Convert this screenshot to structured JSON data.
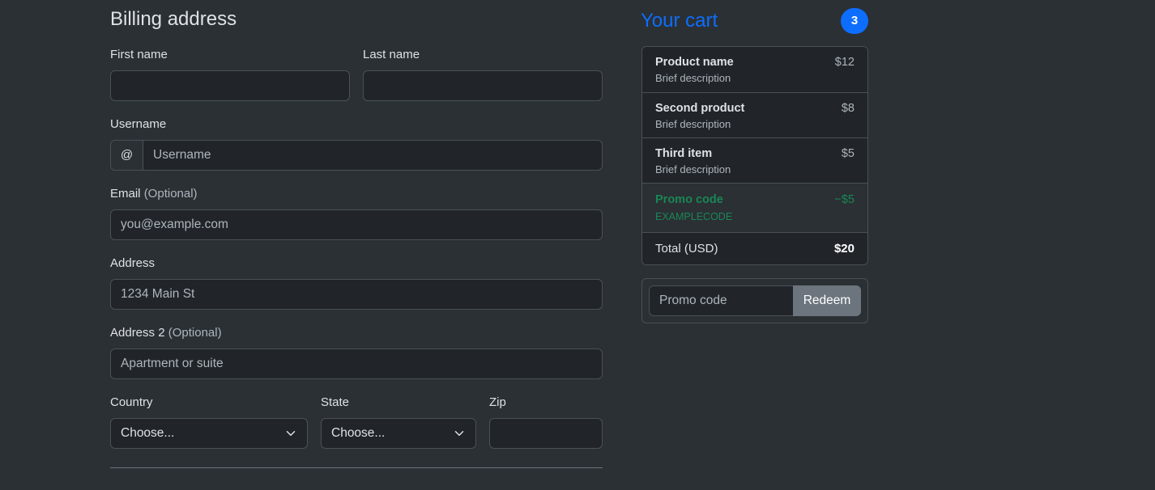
{
  "form": {
    "title": "Billing address",
    "first_name_label": "First name",
    "last_name_label": "Last name",
    "username_label": "Username",
    "username_prefix": "@",
    "username_placeholder": "Username",
    "email_label": "Email",
    "email_optional": "(Optional)",
    "email_placeholder": "you@example.com",
    "address_label": "Address",
    "address_value": "1234 Main St",
    "address2_label": "Address 2",
    "address2_optional": "(Optional)",
    "address2_placeholder": "Apartment or suite",
    "country_label": "Country",
    "country_selected": "Choose...",
    "state_label": "State",
    "state_selected": "Choose...",
    "zip_label": "Zip"
  },
  "cart": {
    "title": "Your cart",
    "count": "3",
    "items": [
      {
        "name": "Product name",
        "desc": "Brief description",
        "price": "$12"
      },
      {
        "name": "Second product",
        "desc": "Brief description",
        "price": "$8"
      },
      {
        "name": "Third item",
        "desc": "Brief description",
        "price": "$5"
      }
    ],
    "promo": {
      "name": "Promo code",
      "code": "EXAMPLECODE",
      "amount": "−$5"
    },
    "total": {
      "label": "Total (USD)",
      "amount": "$20"
    }
  },
  "promo_form": {
    "placeholder": "Promo code",
    "button": "Redeem"
  },
  "colors": {
    "background": "#2b3035",
    "input_bg": "#212529",
    "border": "#495057",
    "primary": "#0d6efd",
    "success": "#198754",
    "secondary": "#6c757d"
  }
}
